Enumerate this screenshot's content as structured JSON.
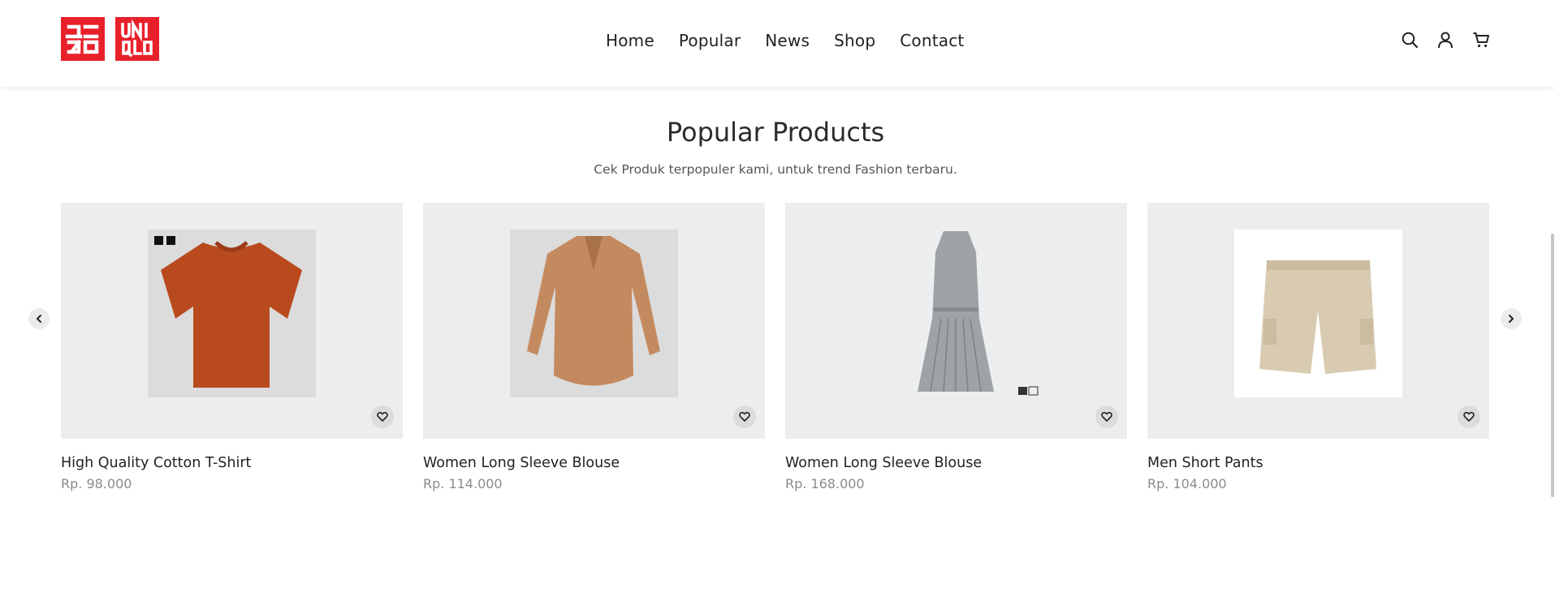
{
  "brand": {
    "name": "UNIQLO",
    "color": "#e8202a"
  },
  "nav": {
    "items": [
      {
        "label": "Home"
      },
      {
        "label": "Popular"
      },
      {
        "label": "News"
      },
      {
        "label": "Shop"
      },
      {
        "label": "Contact"
      }
    ]
  },
  "header_icons": [
    "search-icon",
    "user-icon",
    "cart-icon"
  ],
  "section": {
    "title": "Popular Products",
    "subtitle": "Cek Produk terpopuler kami, untuk trend Fashion terbaru."
  },
  "products": [
    {
      "name": "High Quality Cotton T-Shirt",
      "price": "Rp. 98.000",
      "image": "orange-tshirt",
      "color": "#b84a1e"
    },
    {
      "name": "Women Long Sleeve Blouse",
      "price": "Rp. 114.000",
      "image": "tan-blouse",
      "color": "#c48a5f"
    },
    {
      "name": "Women Long Sleeve Blouse",
      "price": "Rp. 168.000",
      "image": "grey-pleated-dress",
      "color": "#9ea4a6"
    },
    {
      "name": "Men Short Pants",
      "price": "Rp. 104.000",
      "image": "beige-cargo-shorts",
      "color": "#d9cbb2"
    }
  ],
  "carousel": {
    "prev_icon": "chevron-left-icon",
    "next_icon": "chevron-right-icon"
  }
}
